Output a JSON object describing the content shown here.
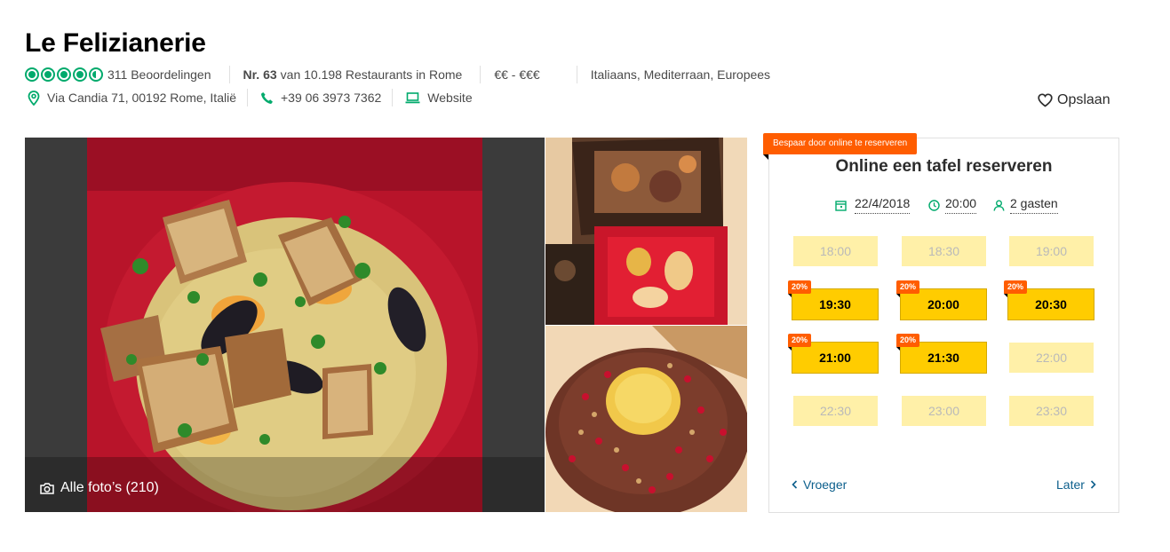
{
  "restaurant": {
    "name": "Le Felizianerie",
    "rating_bubbles": 4.5,
    "reviews": "311 Beoordelingen",
    "rank_prefix": "Nr. 63",
    "rank_rest": "van 10.198 Restaurants in Rome",
    "price": "€€ - €€€",
    "cuisines": "Italiaans, Mediterraan, Europees",
    "address": "Via Candia 71, 00192 Rome, Italië",
    "phone": "+39 06 3973 7362",
    "website": "Website",
    "save_label": "Opslaan"
  },
  "photos": {
    "caption": "Alle foto’s (210)"
  },
  "reservation": {
    "promo": "Bespaar door online te reserveren",
    "title": "Online een tafel reserveren",
    "date": "22/4/2018",
    "time": "20:00",
    "guests": "2 gasten",
    "slots": [
      {
        "time": "18:00",
        "available": false,
        "badge": ""
      },
      {
        "time": "18:30",
        "available": false,
        "badge": ""
      },
      {
        "time": "19:00",
        "available": false,
        "badge": ""
      },
      {
        "time": "19:30",
        "available": true,
        "badge": "20%"
      },
      {
        "time": "20:00",
        "available": true,
        "badge": "20%"
      },
      {
        "time": "20:30",
        "available": true,
        "badge": "20%"
      },
      {
        "time": "21:00",
        "available": true,
        "badge": "20%"
      },
      {
        "time": "21:30",
        "available": true,
        "badge": "20%"
      },
      {
        "time": "22:00",
        "available": false,
        "badge": ""
      },
      {
        "time": "22:30",
        "available": false,
        "badge": ""
      },
      {
        "time": "23:00",
        "available": false,
        "badge": ""
      },
      {
        "time": "23:30",
        "available": false,
        "badge": ""
      }
    ],
    "earlier_label": "Vroeger",
    "later_label": "Later"
  },
  "colors": {
    "brand_green": "#00aa6c",
    "promo_orange": "#ff5d00",
    "slot_available": "#ffcc00",
    "slot_unavailable": "#fff0a8",
    "link_blue": "#0c5f8c"
  }
}
